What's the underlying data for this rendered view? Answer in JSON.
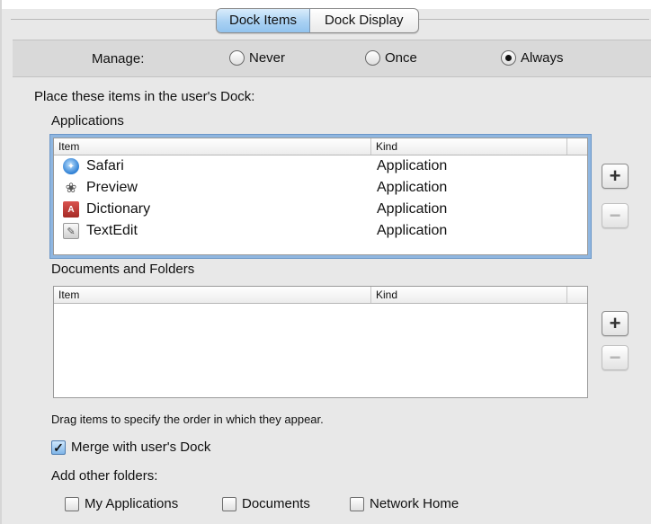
{
  "tabs": [
    {
      "label": "Dock Items",
      "selected": true
    },
    {
      "label": "Dock Display",
      "selected": false
    }
  ],
  "manage": {
    "label": "Manage:",
    "options": [
      {
        "label": "Never",
        "selected": false
      },
      {
        "label": "Once",
        "selected": false
      },
      {
        "label": "Always",
        "selected": true
      }
    ]
  },
  "instruction": "Place these items in the user's Dock:",
  "applications": {
    "title": "Applications",
    "columns": [
      "Item",
      "Kind"
    ],
    "rows": [
      {
        "icon": "safari-icon",
        "item": "Safari",
        "kind": "Application"
      },
      {
        "icon": "preview-icon",
        "item": "Preview",
        "kind": "Application"
      },
      {
        "icon": "dictionary-icon",
        "item": "Dictionary",
        "kind": "Application"
      },
      {
        "icon": "textedit-icon",
        "item": "TextEdit",
        "kind": "Application"
      }
    ]
  },
  "documents": {
    "title": "Documents and Folders",
    "columns": [
      "Item",
      "Kind"
    ],
    "rows": []
  },
  "buttons": {
    "add": "+",
    "remove": "−"
  },
  "drag_hint": "Drag items to specify the order in which they appear.",
  "merge": {
    "label": "Merge with user's Dock",
    "checked": true
  },
  "add_other": {
    "label": "Add other folders:",
    "options": [
      {
        "label": "My Applications",
        "checked": false
      },
      {
        "label": "Documents",
        "checked": false
      },
      {
        "label": "Network Home",
        "checked": false
      }
    ]
  },
  "colors": {
    "selected_tab": "#a9d1f3",
    "focus_ring": "#8fb6e0",
    "checkbox_on": "#7fb5e8"
  }
}
